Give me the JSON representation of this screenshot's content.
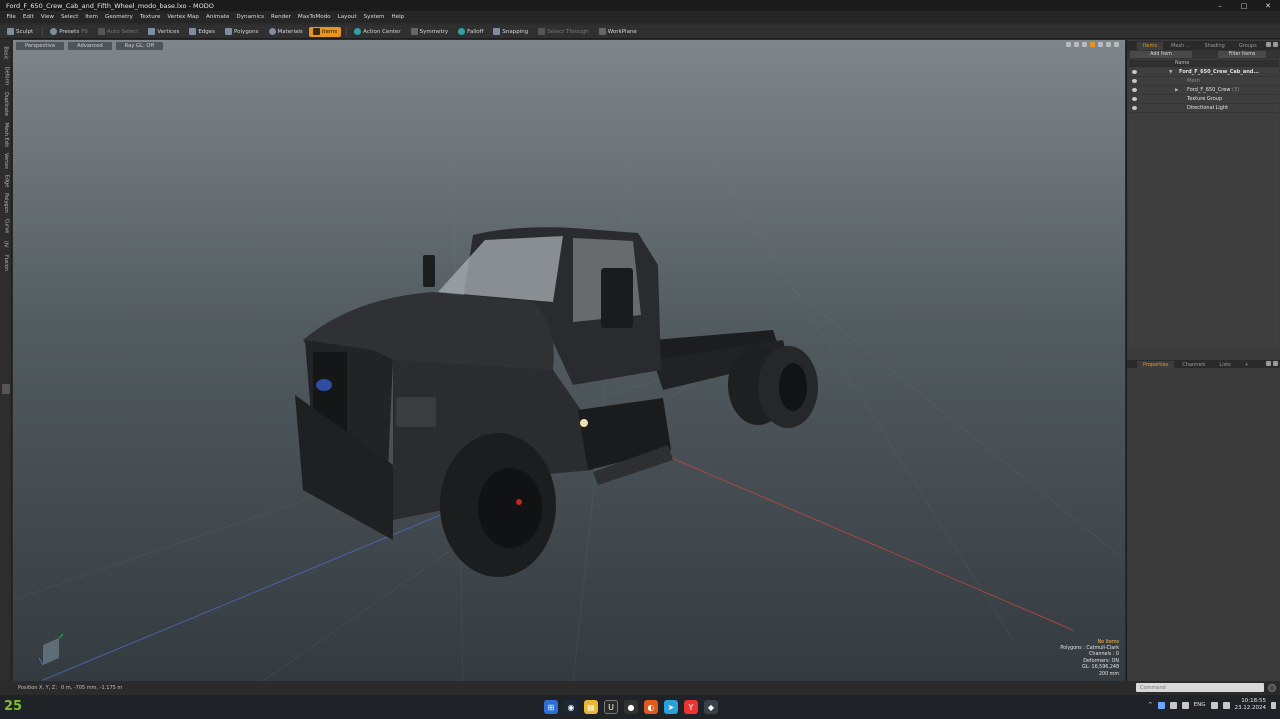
{
  "window": {
    "title": "Ford_F_650_Crew_Cab_and_Fifth_Wheel_modo_base.lxo - MODO",
    "controls": [
      "–",
      "□",
      "✕"
    ]
  },
  "menu": [
    "File",
    "Edit",
    "View",
    "Select",
    "Item",
    "Geometry",
    "Texture",
    "Vertex Map",
    "Animate",
    "Dynamics",
    "Render",
    "MaxToModo",
    "Layout",
    "System",
    "Help"
  ],
  "toolbar": {
    "sculpt": "Sculpt",
    "presets": "Presets",
    "presets_key": "F6",
    "auto_select": "Auto Select",
    "vertices": "Vertices",
    "edges": "Edges",
    "polygons": "Polygons",
    "materials": "Materials",
    "items": "Items",
    "action_center": "Action Center",
    "symmetry": "Symmetry",
    "falloff": "Falloff",
    "snapping": "Snapping",
    "select_through": "Select Through",
    "workplane": "WorkPlane"
  },
  "left_tabs": [
    "Basic",
    "Deform",
    "Duplicate",
    "Mesh Edit",
    "Vertex",
    "Edge",
    "Polygon",
    "Curve",
    "UV",
    "Fusion"
  ],
  "viewport": {
    "tabs": [
      "Perspective",
      "Advanced",
      "Ray GL: Off"
    ],
    "info": {
      "no_items": "No Items",
      "polygons": "Polygons : Catmull-Clark",
      "channels": "Channels : 0",
      "deformers": "Deformers: ON",
      "gl": "GL: 16,596,248",
      "scale": "200 mm"
    }
  },
  "items_panel": {
    "tabs": [
      "Items",
      "Mesh ...",
      "Shading",
      "Groups"
    ],
    "add_item": "Add Item",
    "filter_items": "Filter Items",
    "column_name": "Name",
    "tree": [
      {
        "label": "Ford_F_650_Crew_Cab_and...",
        "style": "bold"
      },
      {
        "label": "Mesh",
        "style": "dim"
      },
      {
        "label": "Ford_F_650_Crew",
        "count": "(3)",
        "style": "normal"
      },
      {
        "label": "Texture Group",
        "style": "normal"
      },
      {
        "label": "Directional Light",
        "style": "normal"
      }
    ]
  },
  "properties_panel": {
    "tabs": [
      "Properties",
      "Channels",
      "Lists",
      "+"
    ]
  },
  "status": {
    "position_label": "Position X, Y, Z:",
    "position_value": "0 m, -705 mm, -1.175 m"
  },
  "command": {
    "placeholder": "Command"
  },
  "taskbar": {
    "badge": "25",
    "lang": "ENG",
    "time": "10:18:55",
    "date": "23.12.2024"
  }
}
